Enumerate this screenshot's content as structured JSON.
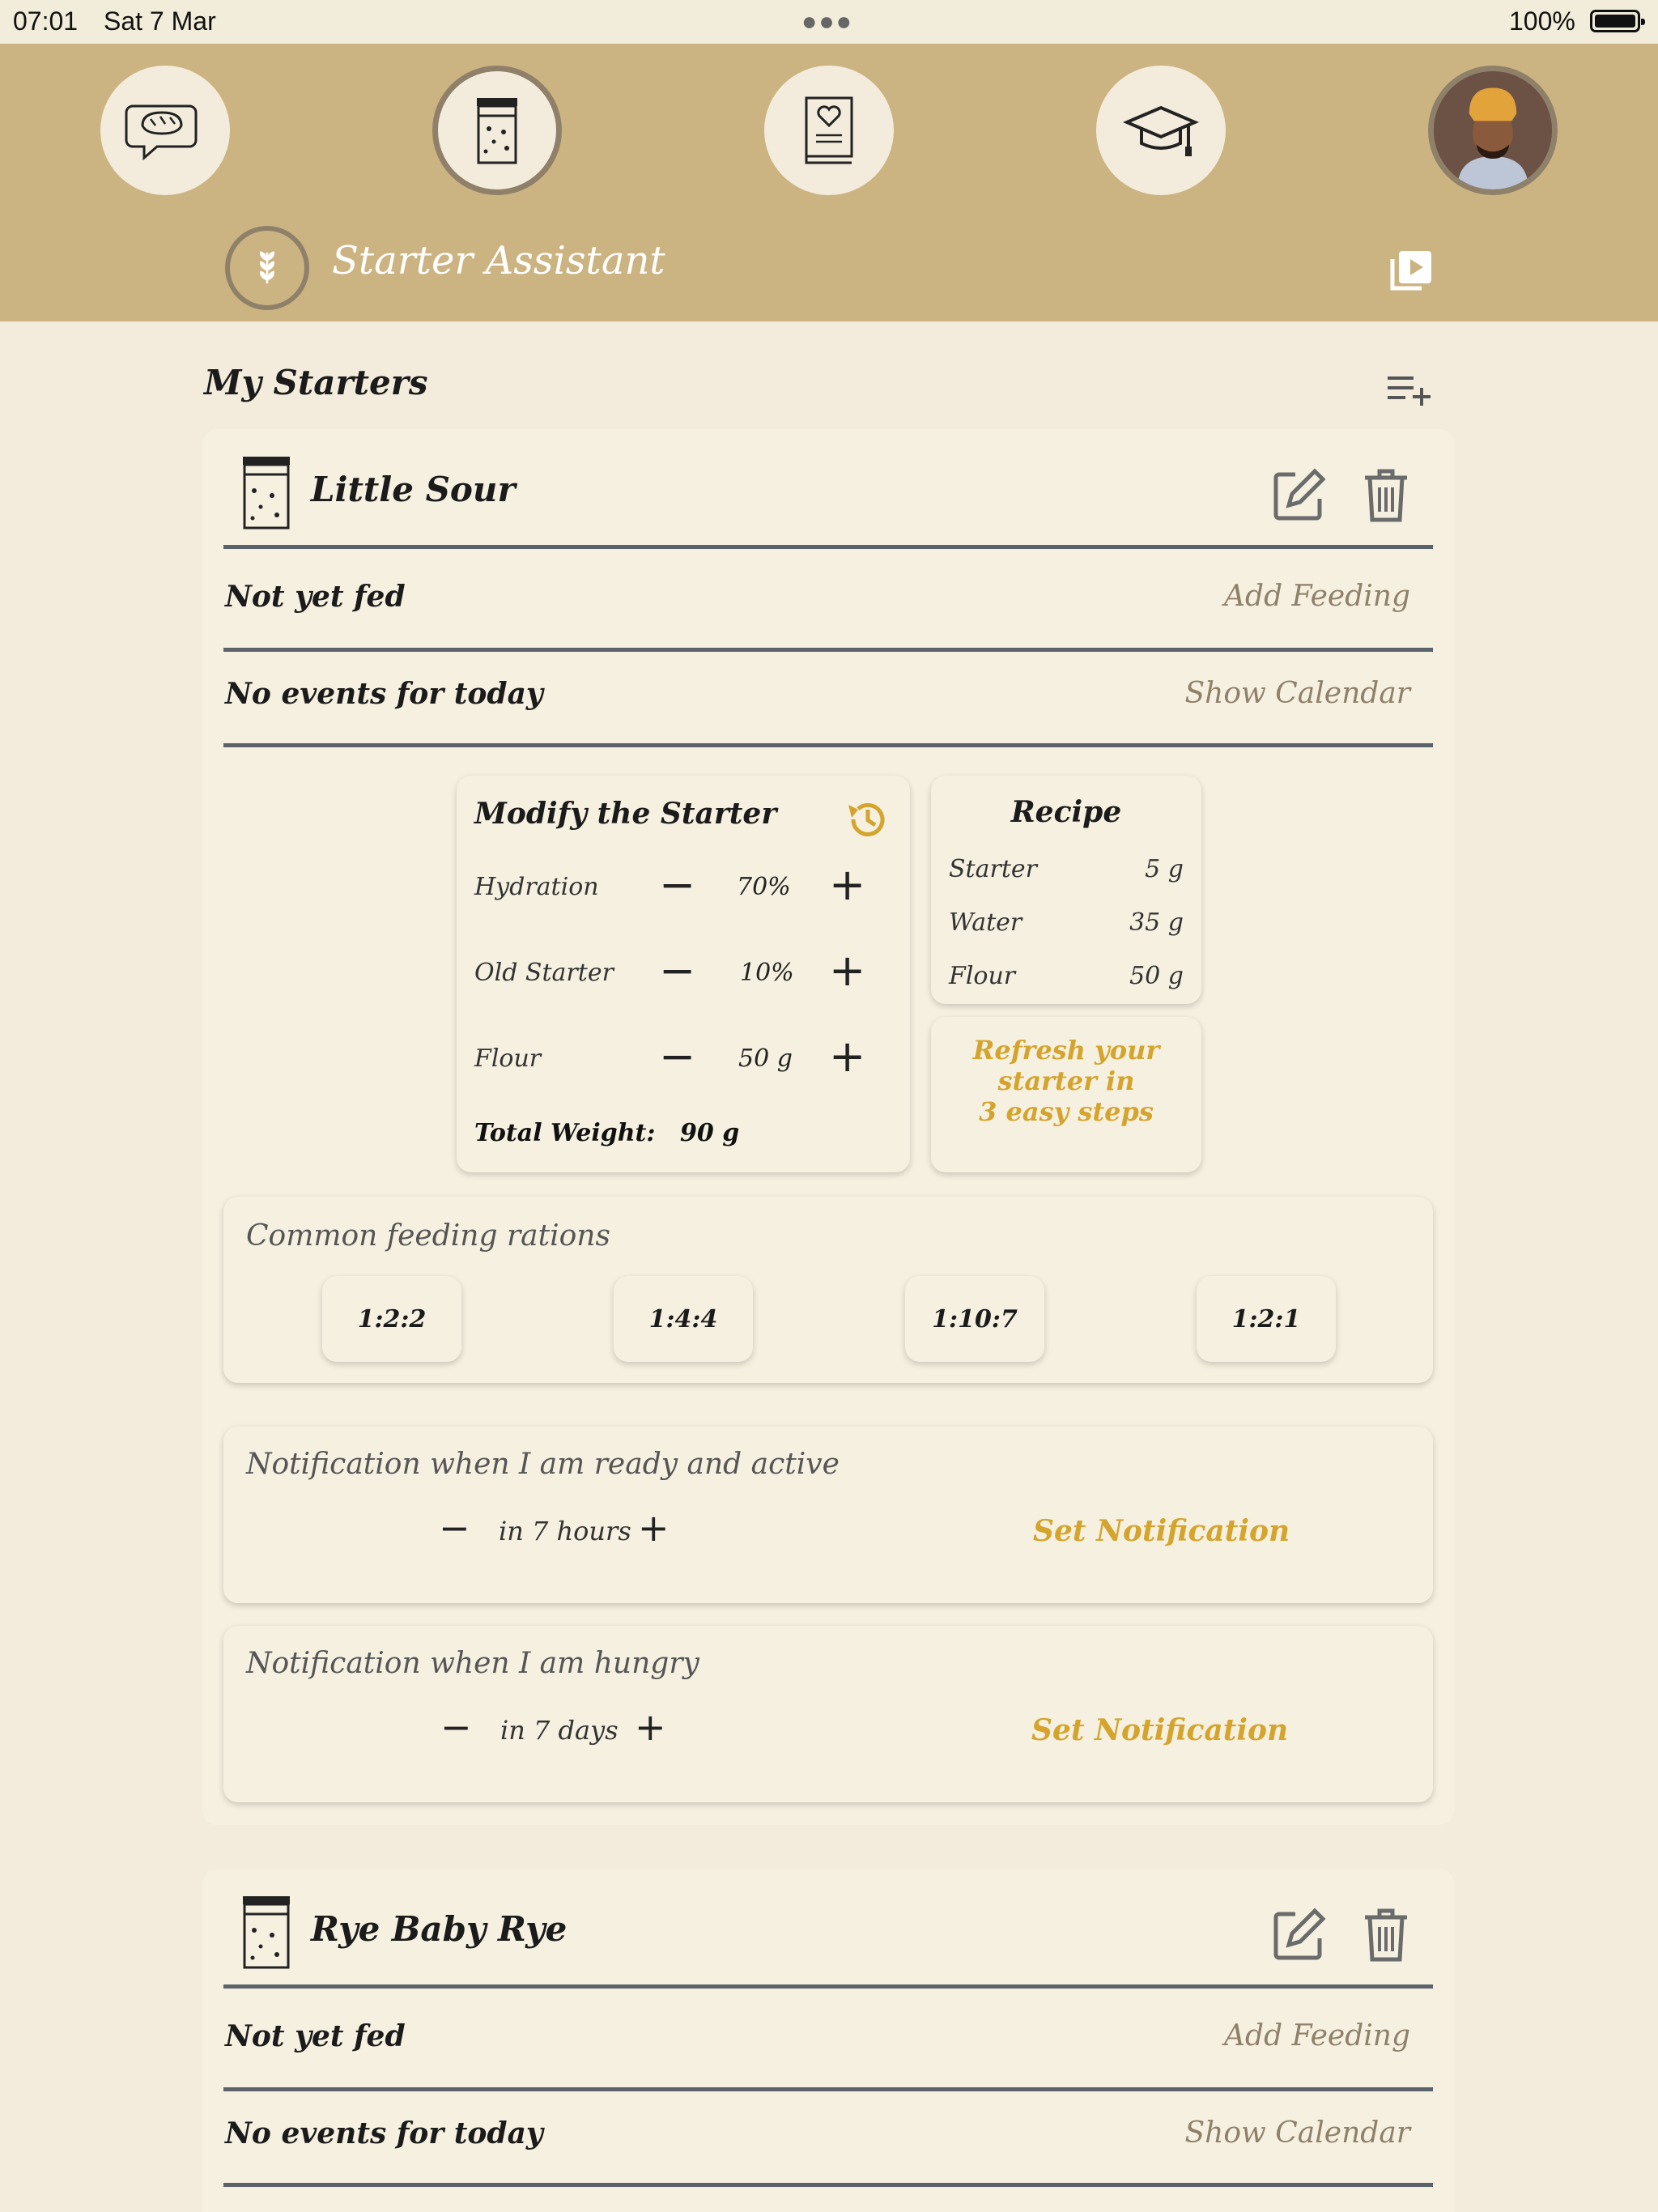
{
  "status_bar": {
    "time": "07:01",
    "date": "Sat 7 Mar",
    "battery": "100%"
  },
  "header": {
    "title": "Starter Assistant"
  },
  "nav": {
    "items": [
      {
        "name": "chat",
        "icon": "bread-chat-icon"
      },
      {
        "name": "starter",
        "icon": "starter-jar-icon",
        "active": true
      },
      {
        "name": "recipes",
        "icon": "recipe-book-icon"
      },
      {
        "name": "learn",
        "icon": "graduation-cap-icon"
      },
      {
        "name": "profile",
        "icon": "user-avatar"
      }
    ]
  },
  "section": {
    "title": "My Starters"
  },
  "starters": [
    {
      "name": "Little Sour",
      "feeding_status": "Not yet fed",
      "add_feeding": "Add Feeding",
      "events": "No events for today",
      "show_calendar": "Show Calendar",
      "modify": {
        "title": "Modify the Starter",
        "hydration_label": "Hydration",
        "hydration_value": "70%",
        "old_starter_label": "Old Starter",
        "old_starter_value": "10%",
        "flour_label": "Flour",
        "flour_value": "50 g",
        "total_label": "Total Weight:",
        "total_value": "90 g"
      },
      "recipe": {
        "title": "Recipe",
        "starter_label": "Starter",
        "starter_value": "5 g",
        "water_label": "Water",
        "water_value": "35 g",
        "flour_label": "Flour",
        "flour_value": "50 g"
      },
      "refresh": {
        "line1": "Refresh your",
        "line2": "starter in",
        "line3": "3 easy steps"
      },
      "rations": {
        "title": "Common feeding rations",
        "options": [
          "1:2:2",
          "1:4:4",
          "1:10:7",
          "1:2:1"
        ]
      },
      "notify_ready": {
        "title": "Notification when I am ready and active",
        "value": "in 7 hours",
        "action": "Set Notification"
      },
      "notify_hungry": {
        "title": "Notification when I am hungry",
        "value": "in 7 days",
        "action": "Set Notification"
      }
    },
    {
      "name": "Rye Baby Rye",
      "feeding_status": "Not yet fed",
      "add_feeding": "Add Feeding",
      "events": "No events for today",
      "show_calendar": "Show Calendar"
    }
  ],
  "colors": {
    "header": "#ccb482",
    "background": "#f3ecdc",
    "card": "#f6f0e0",
    "accent": "#d4a42d",
    "muted": "#8f806a",
    "rule": "#5a636b"
  }
}
